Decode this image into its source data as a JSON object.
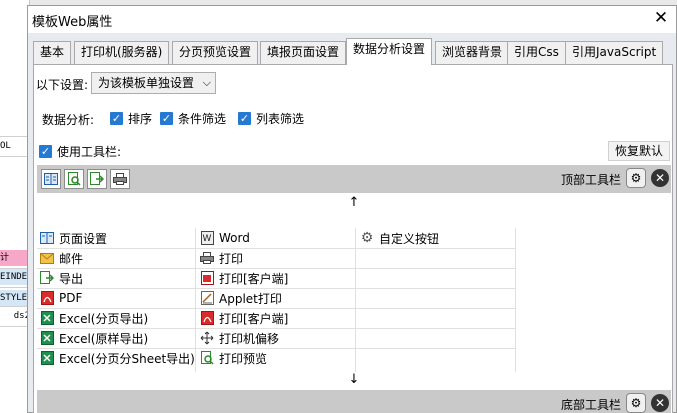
{
  "background": {
    "cells": [
      "OL",
      "计",
      "EINDE",
      "STYLE",
      "ds2"
    ]
  },
  "dialog": {
    "title": "模板Web属性",
    "tabs": [
      {
        "label": "基本"
      },
      {
        "label": "打印机(服务器)"
      },
      {
        "label": "分页预览设置"
      },
      {
        "label": "填报页面设置"
      },
      {
        "label": "数据分析设置",
        "active": true
      },
      {
        "label": "浏览器背景"
      },
      {
        "label": "引用Css"
      },
      {
        "label": "引用JavaScript"
      }
    ],
    "setting_label": "以下设置:",
    "setting_value": "为该模板单独设置",
    "analysis_label": "数据分析:",
    "analysis_options": [
      {
        "label": "排序",
        "checked": true
      },
      {
        "label": "条件筛选",
        "checked": true
      },
      {
        "label": "列表筛选",
        "checked": true
      }
    ],
    "use_toolbar": {
      "label": "使用工具栏:",
      "checked": true
    },
    "restore_button": "恢复默认",
    "top_toolbar_label": "顶部工具栏",
    "bottom_toolbar_label": "底部工具栏",
    "arrow_up": "↑",
    "arrow_down": "↓",
    "items": [
      {
        "label": "页面设置",
        "icon": "page-setup-icon",
        "col": 0,
        "row": 0
      },
      {
        "label": "邮件",
        "icon": "mail-icon",
        "col": 0,
        "row": 1
      },
      {
        "label": "导出",
        "icon": "export-icon",
        "col": 0,
        "row": 2
      },
      {
        "label": "PDF",
        "icon": "pdf-icon",
        "col": 0,
        "row": 3
      },
      {
        "label": "Excel(分页导出)",
        "icon": "excel-icon",
        "col": 0,
        "row": 4
      },
      {
        "label": "Excel(原样导出)",
        "icon": "excel-icon",
        "col": 0,
        "row": 5
      },
      {
        "label": "Excel(分页分Sheet导出)",
        "icon": "excel-icon",
        "col": 0,
        "row": 6
      },
      {
        "label": "Word",
        "icon": "word-icon",
        "col": 1,
        "row": 0
      },
      {
        "label": "打印",
        "icon": "print-icon",
        "col": 1,
        "row": 1
      },
      {
        "label": "打印[客户端]",
        "icon": "pdf-print-icon",
        "col": 1,
        "row": 2
      },
      {
        "label": "Applet打印",
        "icon": "applet-print-icon",
        "col": 1,
        "row": 3
      },
      {
        "label": "打印[客户端]",
        "icon": "pdf-icon",
        "col": 1,
        "row": 4
      },
      {
        "label": "打印机偏移",
        "icon": "move-icon",
        "col": 1,
        "row": 5
      },
      {
        "label": "打印预览",
        "icon": "preview-icon",
        "col": 1,
        "row": 6
      },
      {
        "label": "自定义按钮",
        "icon": "gear-icon",
        "col": 2,
        "row": 0
      }
    ]
  }
}
